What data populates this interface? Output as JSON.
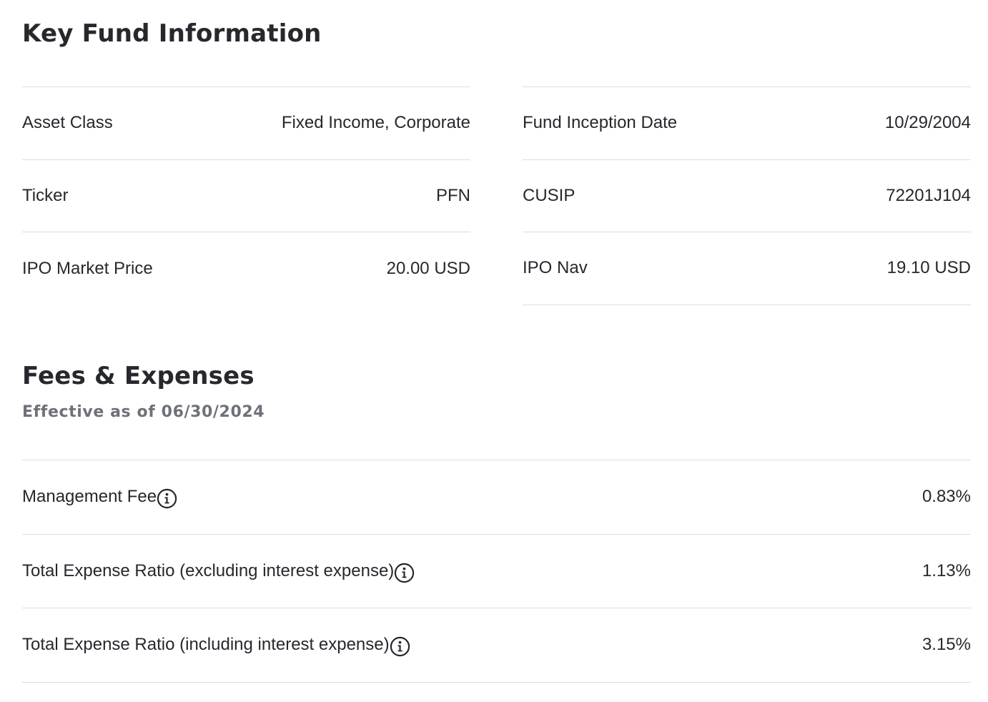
{
  "key_fund_info": {
    "title": "Key Fund Information",
    "left": [
      {
        "label": "Asset Class",
        "value": "Fixed Income, Corporate"
      },
      {
        "label": "Ticker",
        "value": "PFN"
      },
      {
        "label": "IPO Market Price",
        "value": "20.00 USD"
      }
    ],
    "right": [
      {
        "label": "Fund Inception Date",
        "value": "10/29/2004"
      },
      {
        "label": "CUSIP",
        "value": "72201J104"
      },
      {
        "label": "IPO Nav",
        "value": "19.10 USD"
      }
    ]
  },
  "fees": {
    "title": "Fees & Expenses",
    "subtitle": "Effective as of 06/30/2024",
    "rows": [
      {
        "label": "Management Fee",
        "value": "0.83%",
        "icon": "info-icon"
      },
      {
        "label": "Total Expense Ratio (excluding interest expense)",
        "value": "1.13%",
        "icon": "info-icon"
      },
      {
        "label": "Total Expense Ratio (including interest expense)",
        "value": "3.15%",
        "icon": "info-icon"
      }
    ]
  },
  "colors": {
    "text": "#26282d",
    "muted": "#6e7178",
    "divider": "#dcdde0"
  }
}
